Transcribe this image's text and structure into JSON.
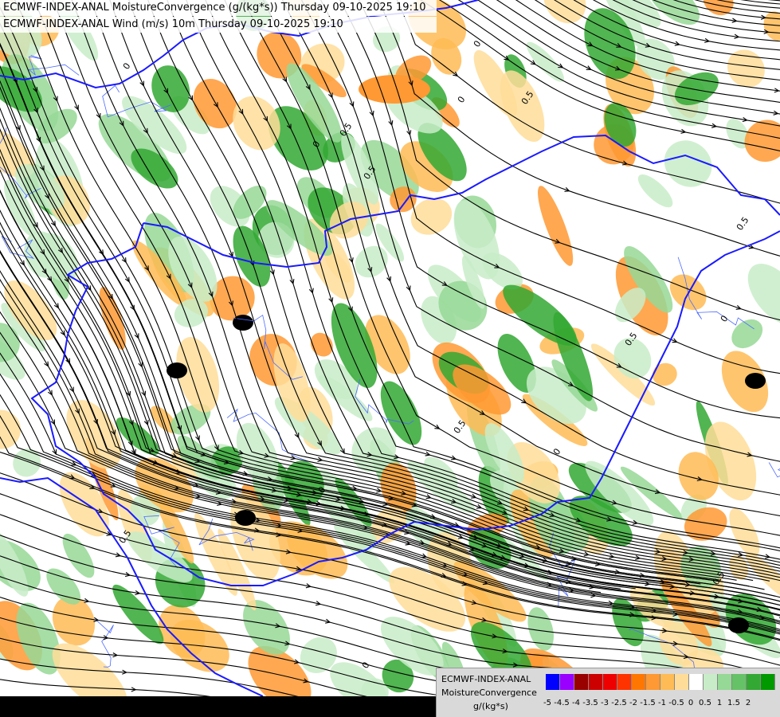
{
  "header": {
    "line1": "ECMWF-INDEX-ANAL MoistureConvergence (g/(kg*s)) Thursday 09-10-2025 19:10",
    "line2": "ECMWF-INDEX-ANAL Wind (m/s) 10m Thursday 09-10-2025 19:10"
  },
  "legend": {
    "model": "ECMWF-INDEX-ANAL",
    "parameter": "MoistureConvergence",
    "unit": "g/(kg*s)",
    "colors": [
      "#0000ff",
      "#9900ff",
      "#990000",
      "#cc0000",
      "#ee0000",
      "#ff3300",
      "#ff7700",
      "#ff9933",
      "#ffbb55",
      "#ffdd99",
      "#ffffff",
      "#c8ecc8",
      "#96d896",
      "#66c266",
      "#33a833",
      "#009900"
    ],
    "ticks": [
      "-5",
      "-4.5",
      "-4",
      "-3.5",
      "-3",
      "-2.5",
      "-2",
      "-1.5",
      "-1",
      "-0.5",
      "0",
      "0.5",
      "1",
      "1.5",
      "2"
    ]
  },
  "map": {
    "contour_labels": [
      "0",
      "0.5",
      "0",
      "0.5",
      "0",
      "0.5",
      "0",
      "0.5",
      "0",
      "0.5",
      "0",
      "0.5",
      "0",
      "0.5",
      "0",
      "0.5"
    ],
    "colors": {
      "background": "#ffffff",
      "convergence_light": "#c8ecc8",
      "convergence_mid": "#96d896",
      "convergence_strong": "#33a833",
      "divergence_light": "#ffdd99",
      "divergence_mid": "#ffbb55",
      "divergence_strong": "#ff9933",
      "border": "#1a1aff",
      "river": "#4d6bff",
      "streamline": "#000000"
    }
  }
}
